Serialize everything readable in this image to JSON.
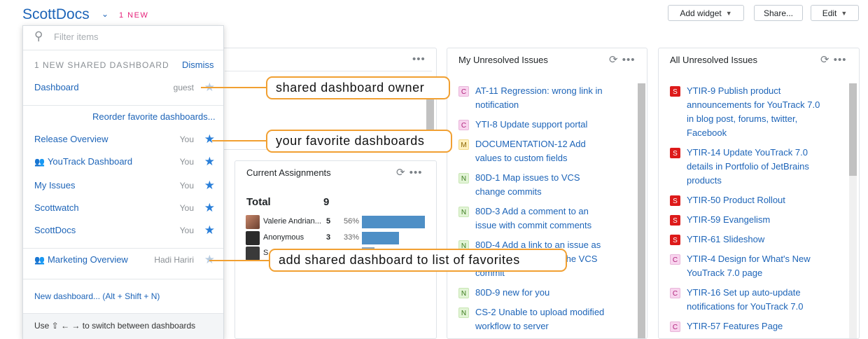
{
  "header": {
    "title": "ScottDocs",
    "new_badge": "1 NEW",
    "add_widget": "Add widget",
    "share": "Share...",
    "edit": "Edit"
  },
  "dropdown": {
    "filter_placeholder": "Filter items",
    "shared_header": "1 NEW SHARED DASHBOARD",
    "dismiss": "Dismiss",
    "shared_item": {
      "label": "Dashboard",
      "owner": "guest",
      "favorite": false
    },
    "reorder": "Reorder favorite dashboards...",
    "favorites": [
      {
        "label": "Release Overview",
        "owner": "You",
        "favorite": true,
        "shared": false
      },
      {
        "label": "YouTrack Dashboard",
        "owner": "You",
        "favorite": true,
        "shared": true
      },
      {
        "label": "My Issues",
        "owner": "You",
        "favorite": true,
        "shared": false
      },
      {
        "label": "Scottwatch",
        "owner": "You",
        "favorite": true,
        "shared": false
      },
      {
        "label": "ScottDocs",
        "owner": "You",
        "favorite": true,
        "shared": false
      }
    ],
    "other": {
      "label": "Marketing Overview",
      "owner": "Hadi Hariri",
      "favorite": false,
      "shared": true
    },
    "new_dashboard": "New dashboard... (Alt + Shift + N)",
    "footer_hint": "Use ⇧ ← → to switch between dashboards"
  },
  "callouts": {
    "owner": "shared dashboard owner",
    "favorites": "your favorite dashboards",
    "add": "add shared dashboard to list of favorites"
  },
  "assignments": {
    "title": "Current Assignments",
    "total_label": "Total",
    "total_value": "9",
    "rows": [
      {
        "name": "Valerie Andrian...",
        "count": "5",
        "percent": "56%",
        "share": 0.56
      },
      {
        "name": "Anonymous",
        "count": "3",
        "percent": "33%",
        "share": 0.33
      },
      {
        "name": "S",
        "count": "",
        "percent": "",
        "share": 0.11
      }
    ]
  },
  "my_unresolved": {
    "title": "My Unresolved Issues",
    "issues": [
      {
        "tag": "C",
        "text": "AT-11  Regression: wrong link in notification"
      },
      {
        "tag": "C",
        "text": "YTI-8  Update support portal"
      },
      {
        "tag": "M",
        "text": "DOCUMENTATION-12  Add values to custom fields"
      },
      {
        "tag": "N",
        "text": "80D-1  Map issues to VCS change commits"
      },
      {
        "tag": "N",
        "text": "80D-3  Add a comment to an issue with commit comments"
      },
      {
        "tag": "N",
        "text": "80D-4  Add a link to an issue as"
      },
      {
        "tag": "N",
        "text": "80D-9  new for you"
      },
      {
        "tag": "N",
        "text": "CS-2  Unable to upload modified workflow to server"
      }
    ],
    "partial_lines": [
      "the VCS",
      "commit"
    ]
  },
  "all_unresolved": {
    "title": "All Unresolved Issues",
    "issues": [
      {
        "tag": "S",
        "text": "YTIR-9  Publish product announcements for YouTrack 7.0 in blog post, forums, twitter, Facebook"
      },
      {
        "tag": "S",
        "text": "YTIR-14  Update YouTrack 7.0 details in Portfolio of JetBrains products"
      },
      {
        "tag": "S",
        "text": "YTIR-50  Product Rollout"
      },
      {
        "tag": "S",
        "text": "YTIR-59  Evangelism"
      },
      {
        "tag": "S",
        "text": "YTIR-61  Slideshow"
      },
      {
        "tag": "C",
        "text": "YTIR-4  Design for What's New YouTrack 7.0 page"
      },
      {
        "tag": "C",
        "text": "YTIR-16  Set up auto-update notifications for YouTrack 7.0"
      },
      {
        "tag": "C",
        "text": "YTIR-57  Features Page"
      }
    ]
  },
  "colors": {
    "accent": "#1d64b8",
    "badge": "#e5227a",
    "callout_border": "#f1a032",
    "star_on": "#2a7fd9",
    "bar": "#4e8fc6"
  }
}
